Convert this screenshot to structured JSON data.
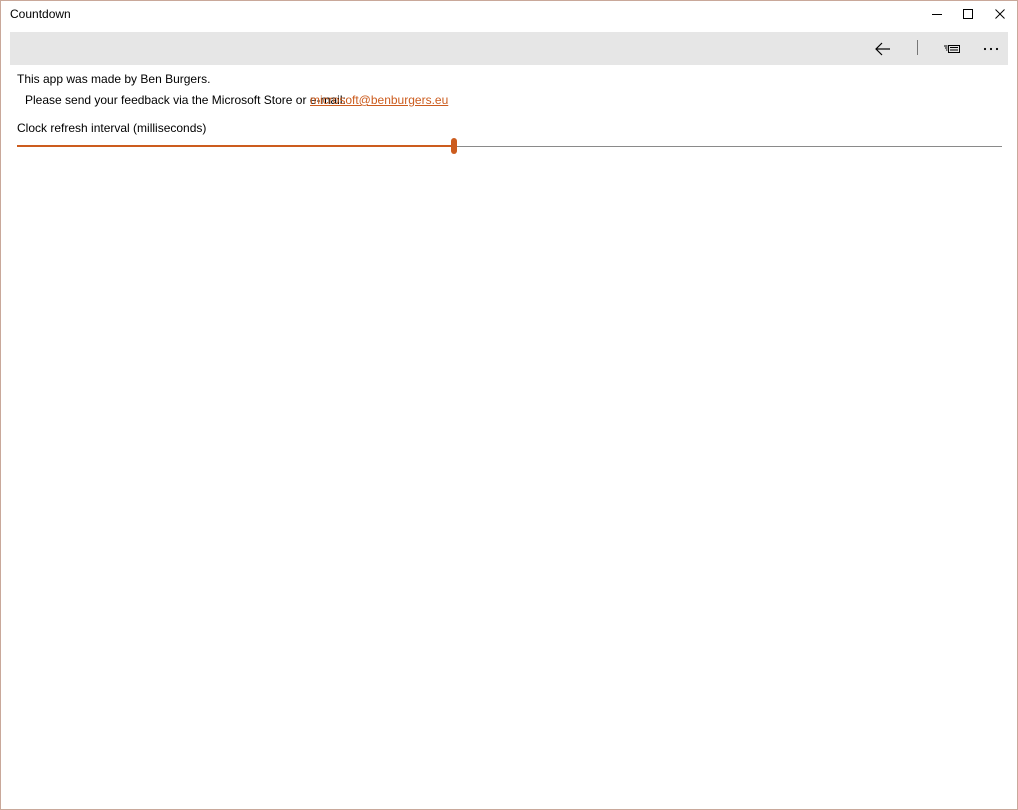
{
  "window": {
    "title": "Countdown",
    "controls": {
      "minimize_icon": "minimize-icon",
      "maximize_icon": "maximize-icon",
      "close_icon": "close-icon"
    }
  },
  "command_bar": {
    "buttons": [
      {
        "icon": "back-arrow-icon"
      },
      {
        "icon": "keyboard-icon"
      },
      {
        "icon": "more-icon"
      }
    ]
  },
  "about": {
    "credit": "This app was made by Ben Burgers.",
    "feedback_label": "Please send your feedback via the Microsoft Store or e-mail:",
    "email": "microsoft@benburgers.eu"
  },
  "settings": {
    "refresh_interval_label": "Clock refresh interval (milliseconds)",
    "refresh_interval_fraction": 0.444
  },
  "colors": {
    "accent": "#cc5c1e",
    "command_bar_bg": "#e6e6e6",
    "track": "#8a8a8a"
  }
}
